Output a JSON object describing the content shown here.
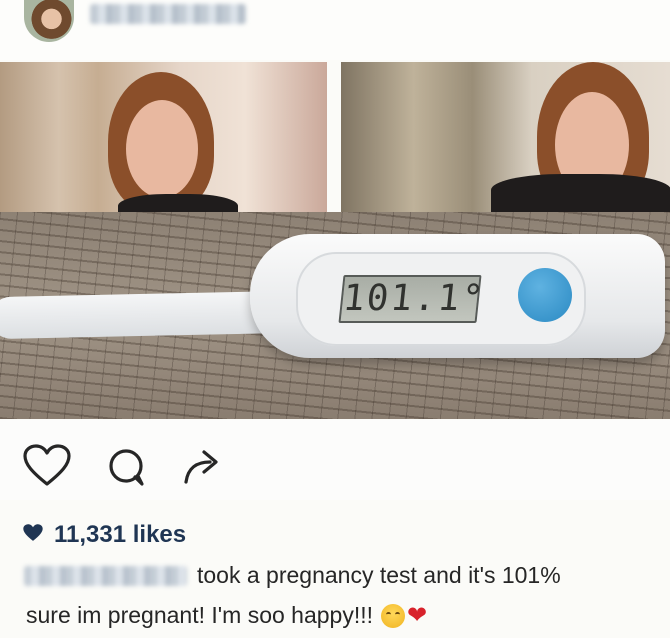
{
  "likes": {
    "heart_icon": "heart-filled-icon",
    "count_text": "11,331 likes",
    "color": "#1f3553"
  },
  "caption": {
    "line1": "took a pregnancy test and it's 101%",
    "line2": "sure im pregnant! I'm soo happy!!!",
    "emojis": [
      "flushed-face-emoji",
      "red-heart-emoji"
    ]
  },
  "post_image": {
    "thermometer_display": "101.1°"
  },
  "actions": {
    "like_icon": "heart-outline-icon",
    "comment_icon": "comment-bubble-icon",
    "share_icon": "share-arrow-icon"
  },
  "colors": {
    "accent_blue": "#2b8ac3",
    "heart_red": "#d8222b",
    "text_dark": "#262626"
  }
}
